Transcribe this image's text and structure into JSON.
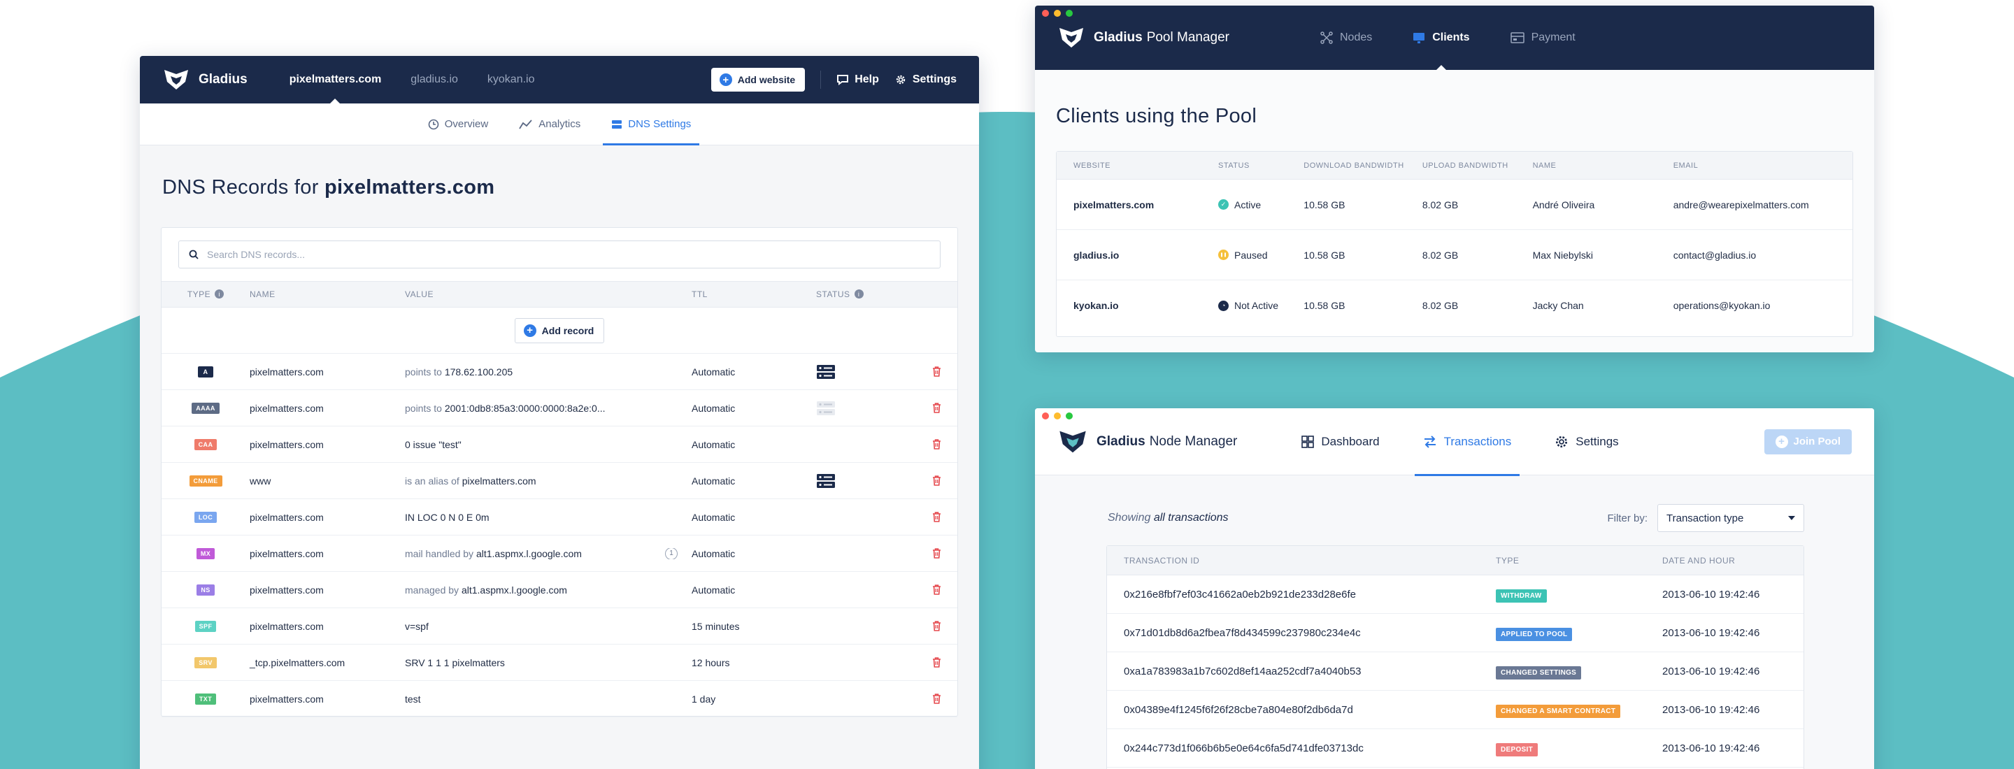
{
  "colors": {
    "navy": "#1b2a4a",
    "teal": "#5cbec3",
    "accent": "#2f7ae5",
    "delete": "#e5484d"
  },
  "dns_app": {
    "brand": "Gladius",
    "sites": [
      "pixelmatters.com",
      "gladius.io",
      "kyokan.io"
    ],
    "add_website": "Add website",
    "help": "Help",
    "settings": "Settings",
    "tabs": [
      "Overview",
      "Analytics",
      "DNS Settings"
    ],
    "title_prefix": "DNS Records for",
    "title_domain": "pixelmatters.com",
    "search_placeholder": "Search DNS records...",
    "columns": [
      "TYPE",
      "NAME",
      "VALUE",
      "TTL",
      "STATUS"
    ],
    "add_record": "Add record",
    "records": [
      {
        "type": "A",
        "color": "#1b2a4a",
        "name": "pixelmatters.com",
        "prefix": "points to",
        "value": "178.62.100.205",
        "ttl": "Automatic",
        "status": "active"
      },
      {
        "type": "AAAA",
        "color": "#5d6b85",
        "name": "pixelmatters.com",
        "prefix": "points to",
        "value": "2001:0db8:85a3:0000:0000:8a2e:0...",
        "ttl": "Automatic",
        "status": "inactive"
      },
      {
        "type": "CAA",
        "color": "#ef7b6a",
        "name": "pixelmatters.com",
        "prefix": "",
        "value": "0 issue \"test\"",
        "ttl": "Automatic",
        "status": "none"
      },
      {
        "type": "CNAME",
        "color": "#f39c3a",
        "name": "www",
        "prefix": "is an alias of",
        "value": "pixelmatters.com",
        "ttl": "Automatic",
        "status": "active"
      },
      {
        "type": "LOC",
        "color": "#7aa6ef",
        "name": "pixelmatters.com",
        "prefix": "",
        "value": "IN LOC 0 N 0 E 0m",
        "ttl": "Automatic",
        "status": "none"
      },
      {
        "type": "MX",
        "color": "#c05ad8",
        "name": "pixelmatters.com",
        "prefix": "mail handled by",
        "value": "alt1.aspmx.l.google.com",
        "ttl": "Automatic",
        "status": "none",
        "bubble": "1"
      },
      {
        "type": "NS",
        "color": "#9b7ee6",
        "name": "pixelmatters.com",
        "prefix": "managed by",
        "value": "alt1.aspmx.l.google.com",
        "ttl": "Automatic",
        "status": "none"
      },
      {
        "type": "SPF",
        "color": "#5dd2c4",
        "name": "pixelmatters.com",
        "prefix": "",
        "value": "v=spf",
        "ttl": "15 minutes",
        "status": "none"
      },
      {
        "type": "SRV",
        "color": "#f2c76b",
        "name": "_tcp.pixelmatters.com",
        "prefix": "",
        "value": "SRV 1 1 1 pixelmatters",
        "ttl": "12 hours",
        "status": "none"
      },
      {
        "type": "TXT",
        "color": "#4fbf7a",
        "name": "pixelmatters.com",
        "prefix": "",
        "value": "test",
        "ttl": "1 day",
        "status": "none"
      }
    ]
  },
  "pool_app": {
    "brand": "Gladius",
    "product": "Pool Manager",
    "nav": [
      "Nodes",
      "Clients",
      "Payment"
    ],
    "title": "Clients using the Pool",
    "columns": [
      "WEBSITE",
      "STATUS",
      "DOWNLOAD BANDWIDTH",
      "UPLOAD BANDWIDTH",
      "NAME",
      "EMAIL"
    ],
    "rows": [
      {
        "website": "pixelmatters.com",
        "status": "Active",
        "status_color": "#3cc3b4",
        "download": "10.58 GB",
        "upload": "8.02 GB",
        "name": "André Oliveira",
        "email": "andre@wearepixelmatters.com"
      },
      {
        "website": "gladius.io",
        "status": "Paused",
        "status_color": "#f5c03b",
        "download": "10.58 GB",
        "upload": "8.02 GB",
        "name": "Max Niebylski",
        "email": "contact@gladius.io"
      },
      {
        "website": "kyokan.io",
        "status": "Not Active",
        "status_color": "#1b2a4a",
        "download": "10.58 GB",
        "upload": "8.02 GB",
        "name": "Jacky Chan",
        "email": "operations@kyokan.io"
      }
    ]
  },
  "node_app": {
    "brand": "Gladius",
    "product": "Node Manager",
    "nav": [
      "Dashboard",
      "Transactions",
      "Settings"
    ],
    "join_pool": "Join Pool",
    "showing_prefix": "Showing",
    "showing_value": "all transactions",
    "filter_label": "Filter by:",
    "filter_value": "Transaction type",
    "columns": [
      "TRANSACTION ID",
      "TYPE",
      "DATE AND HOUR"
    ],
    "rows": [
      {
        "id": "0x216e8fbf7ef03c41662a0eb2b921de233d28e6fe",
        "type": "WITHDRAW",
        "color": "#3cc3b4",
        "date": "2013-06-10 19:42:46"
      },
      {
        "id": "0x71d01db8d6a2fbea7f8d434599c237980c234e4c",
        "type": "APPLIED TO POOL",
        "color": "#4a90e2",
        "date": "2013-06-10 19:42:46"
      },
      {
        "id": "0xa1a783983a1b7c602d8ef14aa252cdf7a4040b53",
        "type": "CHANGED SETTINGS",
        "color": "#6a7894",
        "date": "2013-06-10 19:42:46"
      },
      {
        "id": "0x04389e4f1245f6f26f28cbe7a804e80f2db6da7d",
        "type": "CHANGED A SMART CONTRACT",
        "color": "#f39c3a",
        "date": "2013-06-10 19:42:46"
      },
      {
        "id": "0x244c773d1f066b6b5e0e64c6fa5d741dfe03713dc",
        "type": "DEPOSIT",
        "color": "#ef7b7b",
        "date": "2013-06-10 19:42:46"
      }
    ]
  }
}
